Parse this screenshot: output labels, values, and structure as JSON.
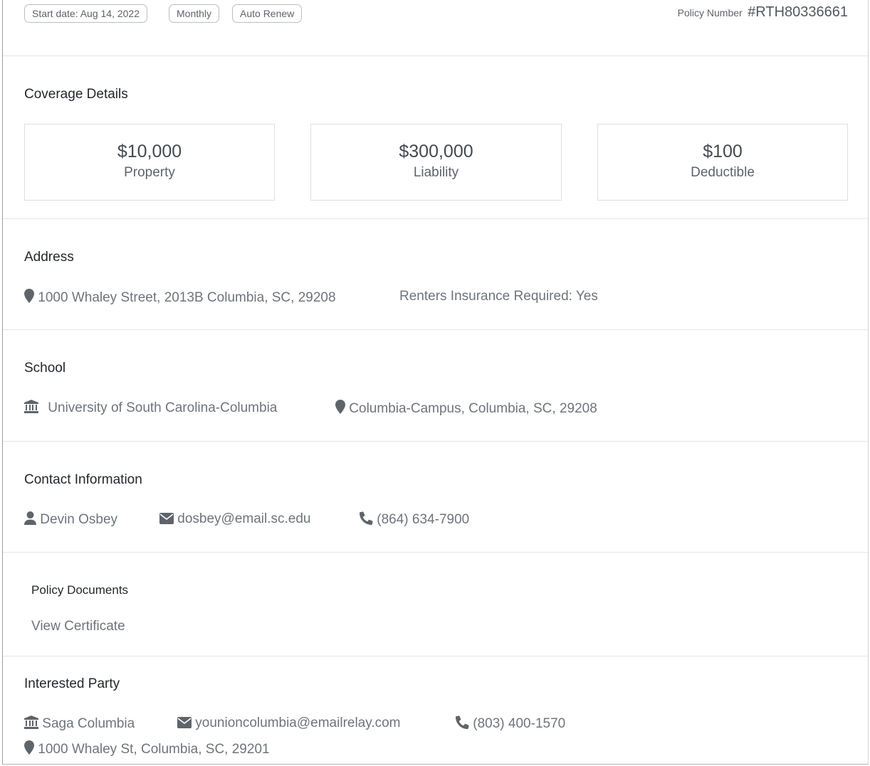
{
  "policy": {
    "badges": [
      "Start date: Aug 14, 2022",
      "Monthly",
      "Auto Renew"
    ],
    "number_label": "Policy Number",
    "number": "#RTH80336661"
  },
  "coverage": {
    "title": "Coverage Details",
    "cards": [
      {
        "amount": "$10,000",
        "label": "Property"
      },
      {
        "amount": "$300,000",
        "label": "Liability"
      },
      {
        "amount": "$100",
        "label": "Deductible"
      }
    ]
  },
  "address": {
    "title": "Address",
    "street": "1000 Whaley Street, 2013B Columbia, SC, 29208",
    "renters": "Renters Insurance Required: Yes"
  },
  "school": {
    "title": "School",
    "name": "University of South Carolina-Columbia",
    "campus": "Columbia-Campus, Columbia, SC, 29208"
  },
  "contact": {
    "title": "Contact Information",
    "name": "Devin Osbey",
    "email": "dosbey@email.sc.edu",
    "phone": "(864) 634-7900"
  },
  "documents": {
    "title": "Policy Documents",
    "link": "View Certificate"
  },
  "interested_party": {
    "title": "Interested Party",
    "name": "Saga Columbia",
    "email": "younioncolumbia@emailrelay.com",
    "phone": "(803) 400-1570",
    "address": "1000 Whaley St, Columbia, SC, 29201"
  },
  "colors": {
    "text": "#1f2329",
    "muted": "#6f747b",
    "border": "#e4e6e9",
    "icon": "#5f646b"
  },
  "icons": [
    "map-marker-icon",
    "bank-icon",
    "user-icon",
    "envelope-icon",
    "phone-icon"
  ]
}
